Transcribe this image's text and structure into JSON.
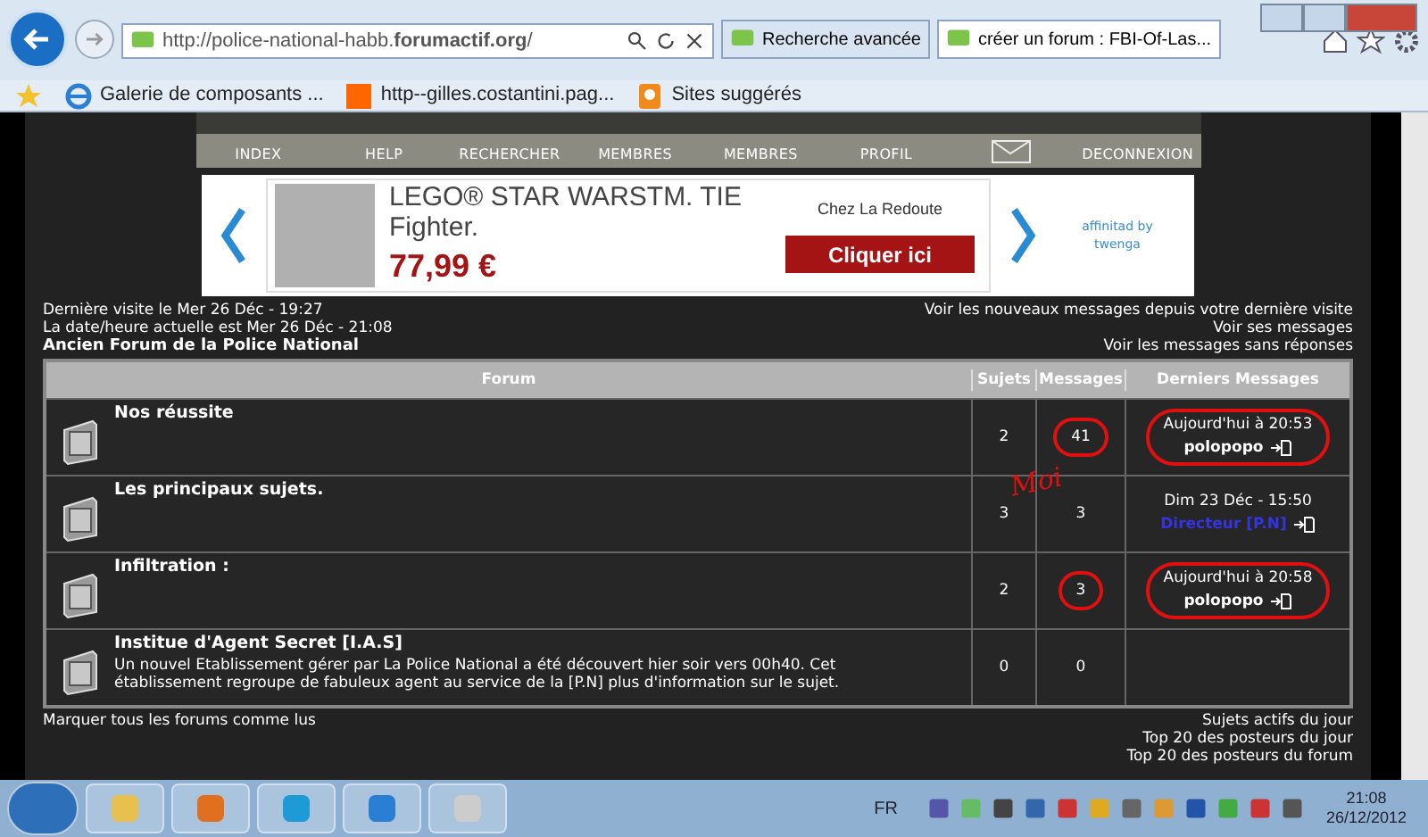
{
  "browser": {
    "url": "http://police-national-habb.**forumactif.org**/",
    "tabs": [
      {
        "label": "Recherche avancée",
        "selected": false
      },
      {
        "label": "créer un forum : FBI-Of-Las...",
        "selected": true
      }
    ],
    "favorites": [
      {
        "kind": "ie",
        "label": "Galerie de composants ..."
      },
      {
        "kind": "orange",
        "label": "http--gilles.costantini.pag..."
      },
      {
        "kind": "bulb",
        "label": "Sites suggérés"
      }
    ]
  },
  "nav": [
    {
      "kind": "text",
      "label": "INDEX"
    },
    {
      "kind": "text",
      "label": "HELP"
    },
    {
      "kind": "text",
      "label": "RECHERCHER"
    },
    {
      "kind": "text",
      "label": "MEMBRES"
    },
    {
      "kind": "text",
      "label": "MEMBRES"
    },
    {
      "kind": "text",
      "label": "PROFIL"
    },
    {
      "kind": "mail"
    },
    {
      "kind": "text",
      "label": "DECONNEXION"
    }
  ],
  "ad": {
    "title": "LEGO® STAR WARSTM. TIE Fighter.",
    "price": "77,99 €",
    "shop": "Chez La Redoute",
    "button": "Cliquer ici",
    "credit": "affinitad by",
    "credit_brand": "twenga"
  },
  "info_left": [
    "Dernière visite le Mer 26 Déc - 19:27",
    "La date/heure actuelle est Mer 26 Déc - 21:08"
  ],
  "forum_title": "Ancien Forum de la Police National",
  "info_right": [
    "Voir les nouveaux messages depuis votre dernière visite",
    "Voir ses messages",
    "Voir les messages sans réponses"
  ],
  "table": {
    "columns": [
      "Forum",
      "Sujets",
      "Messages",
      "Derniers Messages"
    ],
    "rows": [
      {
        "name": "Nos réussite",
        "topics": "2",
        "posts": "41",
        "posts_circled": true,
        "last_date": "Aujourd'hui à 20:53",
        "last_user": "polopopo",
        "color": "#ffffff",
        "last_circled": true
      },
      {
        "name": "Les principaux sujets.",
        "topics": "3",
        "posts": "3",
        "posts_circled": false,
        "last_date": "Dim 23 Déc - 15:50",
        "last_user": "Directeur [P.N]",
        "color": "#3434e0",
        "last_circled": false
      },
      {
        "name": "Infiltration :",
        "topics": "2",
        "posts": "3",
        "posts_circled": true,
        "last_date": "Aujourd'hui à 20:58",
        "last_user": "polopopo",
        "color": "#ffffff",
        "last_circled": true
      },
      {
        "name": "Institue d'Agent Secret [I.A.S]",
        "description": "Un nouvel Etablissement gérer par La Police National a été découvert hier soir vers 00h40. Cet établissement regroupe de fabuleux agent au service de la [P.N] plus d'information sur le sujet.",
        "topics": "0",
        "posts": "0",
        "posts_circled": false
      }
    ]
  },
  "annotation": "Moi",
  "footer_left": "Marquer tous les forums comme lus",
  "footer_right": [
    "Sujets actifs du jour",
    "Top 20 des posteurs du jour",
    "Top 20 des posteurs du forum"
  ],
  "taskbar": {
    "language": "FR",
    "time": "21:08",
    "date": "26/12/2012"
  }
}
